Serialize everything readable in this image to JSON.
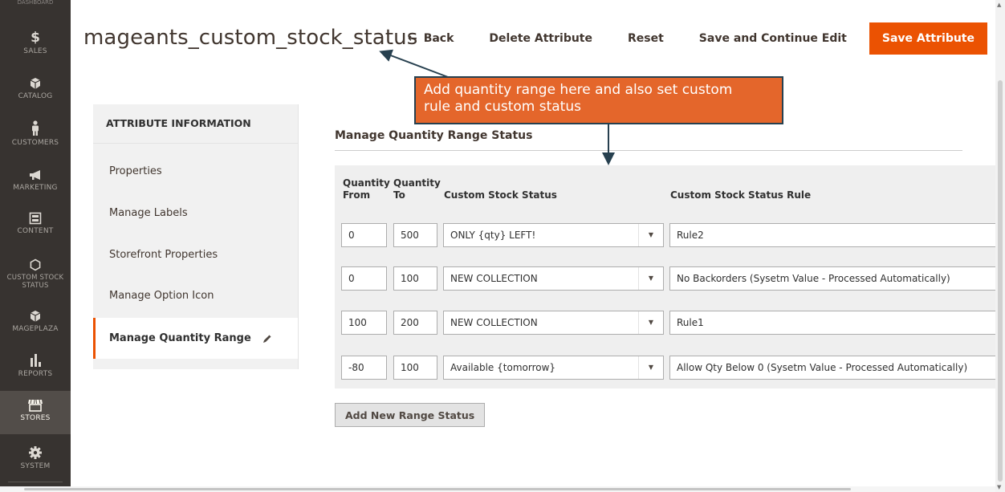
{
  "sidebar": {
    "brand_fragment": "DASHBOARD",
    "items": [
      {
        "label": "SALES",
        "icon": "dollar-icon"
      },
      {
        "label": "CATALOG",
        "icon": "cube-icon"
      },
      {
        "label": "CUSTOMERS",
        "icon": "person-icon"
      },
      {
        "label": "MARKETING",
        "icon": "megaphone-icon"
      },
      {
        "label": "CONTENT",
        "icon": "layout-icon"
      },
      {
        "label": "CUSTOM STOCK STATUS",
        "icon": "hexagon-icon"
      },
      {
        "label": "MAGEPLAZA",
        "icon": "cube-icon"
      },
      {
        "label": "REPORTS",
        "icon": "bar-chart-icon"
      },
      {
        "label": "STORES",
        "icon": "store-icon",
        "active": true
      },
      {
        "label": "SYSTEM",
        "icon": "gear-icon"
      }
    ]
  },
  "header": {
    "title": "mageants_custom_stock_status",
    "actions": {
      "back_arrow": "←",
      "back": "Back",
      "delete": "Delete Attribute",
      "reset": "Reset",
      "save_continue": "Save and Continue Edit",
      "save": "Save Attribute"
    }
  },
  "tabs": {
    "header": "ATTRIBUTE INFORMATION",
    "items": [
      {
        "label": "Properties"
      },
      {
        "label": "Manage Labels"
      },
      {
        "label": "Storefront Properties"
      },
      {
        "label": "Manage Option Icon"
      },
      {
        "label": "Manage Quantity Range",
        "active": true
      }
    ]
  },
  "section": {
    "title": "Manage Quantity Range Status",
    "columns": {
      "qty_from_1": "Quantity",
      "qty_from_2": "From",
      "qty_to_1": "Quantity",
      "qty_to_2": "To",
      "status": "Custom Stock Status",
      "rule": "Custom Stock Status Rule"
    },
    "rows": [
      {
        "from": "0",
        "to": "500",
        "status": "ONLY {qty} LEFT!",
        "rule": "Rule2"
      },
      {
        "from": "0",
        "to": "100",
        "status": "NEW COLLECTION",
        "rule": "No Backorders (Sysetm Value - Processed Automatically)"
      },
      {
        "from": "100",
        "to": "200",
        "status": "NEW COLLECTION",
        "rule": "Rule1"
      },
      {
        "from": "-80",
        "to": "100",
        "status": "Available {tomorrow}",
        "rule": "Allow Qty Below 0 (Sysetm Value - Processed Automatically)"
      }
    ],
    "add_button": "Add New Range Status"
  },
  "annotation": {
    "line1": "Add quantity range here and also set custom",
    "line2": "rule and custom status"
  },
  "colors": {
    "accent": "#eb5202",
    "sidebar_bg": "#373330",
    "callout_bg": "#e4662b",
    "callout_border": "#27404f"
  }
}
